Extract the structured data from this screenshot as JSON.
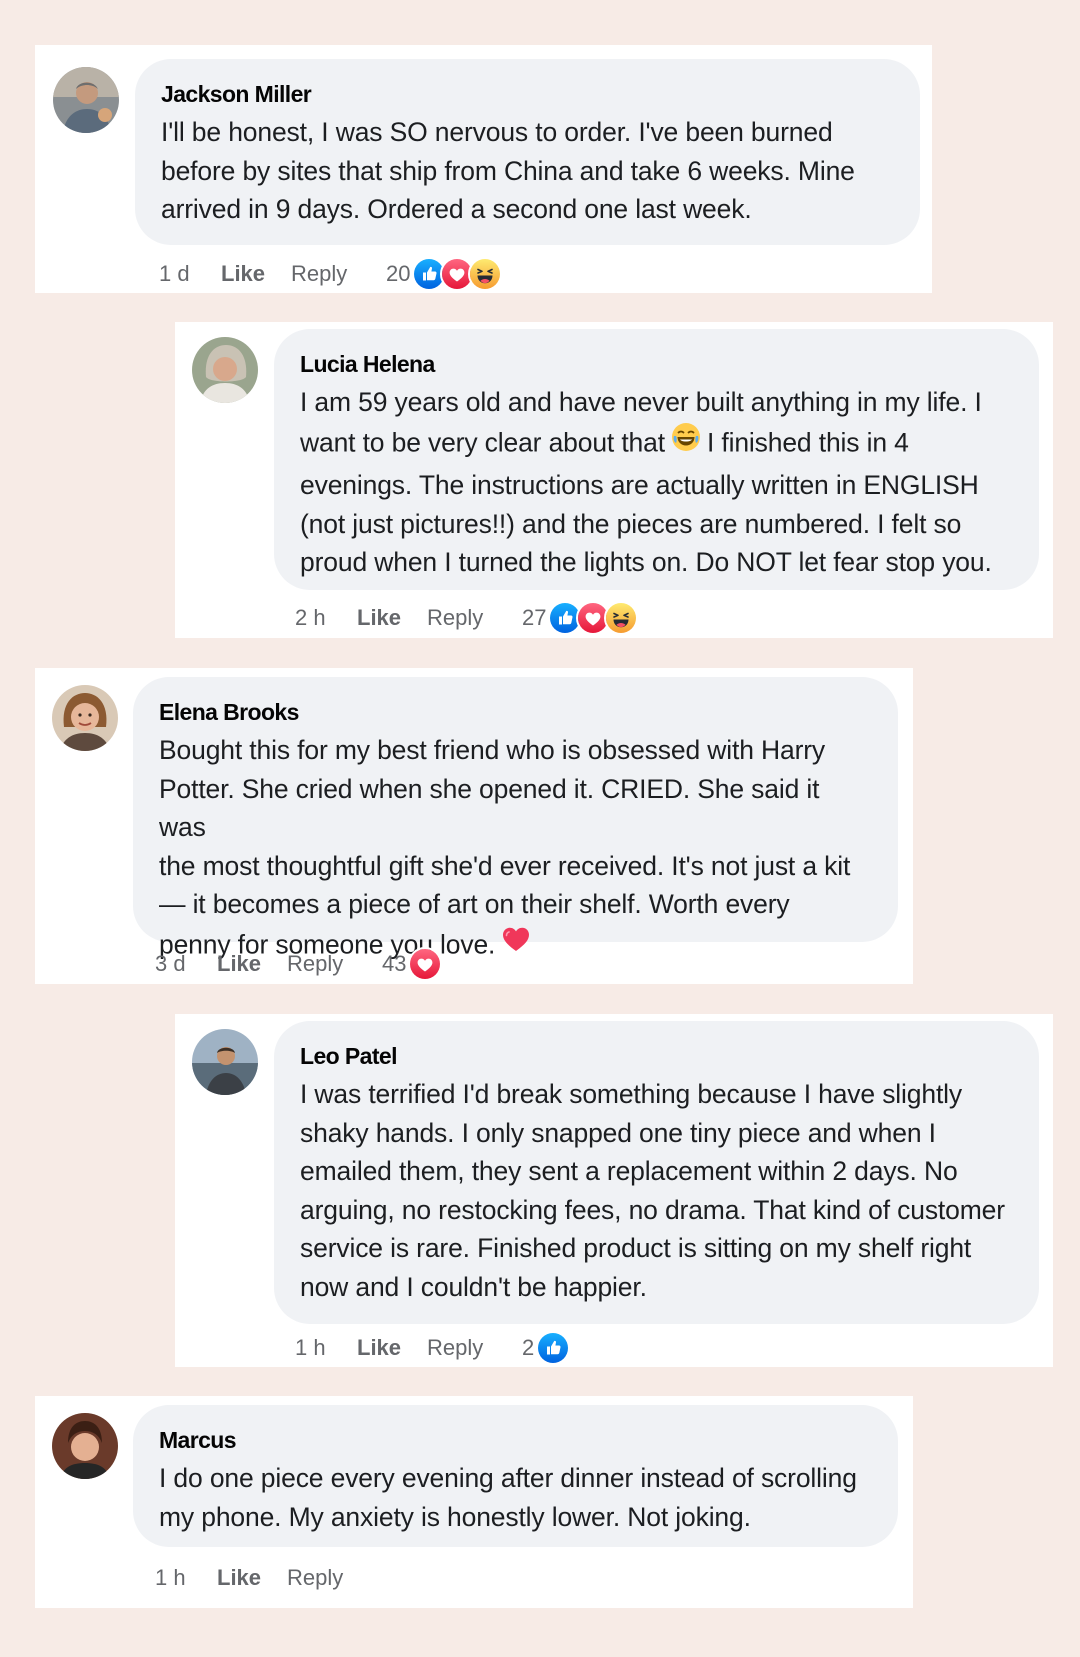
{
  "comments": [
    {
      "name": "Jackson Miller",
      "text": "I'll be honest, I was SO nervous to order. I've been burned\nbefore by sites that ship from China and take 6 weeks. Mine\narrived in 9 days. Ordered a second one last week.",
      "time": "1 d",
      "like": "Like",
      "reply": "Reply",
      "reaction_count": "20",
      "reactions": [
        "like-icon",
        "love-icon",
        "haha-icon"
      ]
    },
    {
      "name": "Lucia Helena",
      "text_before_emoji": "I am 59 years old and have never built anything in my life. I\nwant to be very clear about that",
      "inline_emoji": "laughing-face-icon",
      "text_after_emoji": "I finished this in 4\nevenings. The instructions are actually written in ENGLISH\n(not just pictures!!) and the pieces are numbered. I felt so\nproud when I turned the lights on. Do NOT let fear stop you.",
      "time": "2 h",
      "like": "Like",
      "reply": "Reply",
      "reaction_count": "27",
      "reactions": [
        "like-icon",
        "love-icon",
        "haha-icon"
      ]
    },
    {
      "name": "Elena Brooks",
      "text": "Bought this for my best friend who is obsessed with Harry\nPotter. She cried when she opened it. CRIED. She said it was\nthe most thoughtful gift she'd ever received. It's not just a kit\n— it becomes a piece of art on their shelf. Worth every\npenny for someone you love.",
      "inline_emoji": "heart-icon",
      "time": "3 d",
      "like": "Like",
      "reply": "Reply",
      "reaction_count": "43",
      "reactions": [
        "love-icon"
      ]
    },
    {
      "name": "Leo Patel",
      "text": "I was terrified I'd break something because I have slightly\nshaky hands. I only snapped one tiny piece and when I\nemailed them, they sent a replacement within 2 days. No\narguing, no restocking fees, no drama. That kind of customer\nservice is rare. Finished product is sitting on my shelf right\nnow and I couldn't be happier.",
      "time": "1 h",
      "like": "Like",
      "reply": "Reply",
      "reaction_count": "2",
      "reactions": [
        "like-icon"
      ]
    },
    {
      "name": "Marcus",
      "text": "I do one piece every evening after dinner instead of scrolling\nmy phone. My anxiety is honestly lower. Not joking.",
      "time": "1 h",
      "like": "Like",
      "reply": "Reply"
    }
  ],
  "colors": {
    "page_background": "#f7ebe6",
    "bubble": "#f0f2f5",
    "meta_text": "#65676b",
    "like_blue": "#1877f2",
    "love_red": "#f33e58",
    "haha_yellow": "#f7b125"
  }
}
